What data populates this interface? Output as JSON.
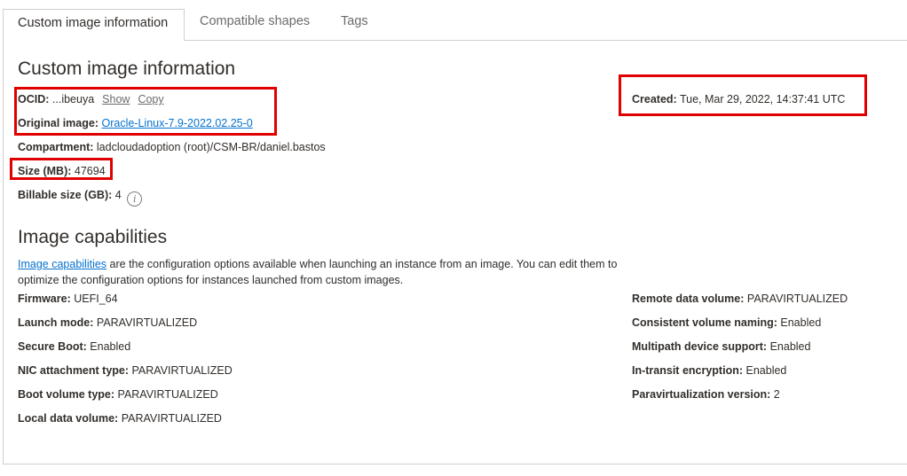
{
  "tabs": [
    {
      "label": "Custom image information",
      "active": true
    },
    {
      "label": "Compatible shapes",
      "active": false
    },
    {
      "label": "Tags",
      "active": false
    }
  ],
  "info": {
    "heading": "Custom image information",
    "ocid_label": "OCID:",
    "ocid_value": "...ibeuya",
    "show_link": "Show",
    "copy_link": "Copy",
    "original_image_label": "Original image:",
    "original_image_value": "Oracle-Linux-7.9-2022.02.25-0",
    "compartment_label": "Compartment:",
    "compartment_value": "ladcloudadoption (root)/CSM-BR/daniel.bastos",
    "size_label": "Size (MB):",
    "size_value": "47694",
    "billable_label": "Billable size (GB):",
    "billable_value": "4",
    "created_label": "Created:",
    "created_value": "Tue, Mar 29, 2022, 14:37:41 UTC"
  },
  "capabilities": {
    "heading": "Image capabilities",
    "desc_link": "Image capabilities",
    "desc_text": " are the configuration options available when launching an instance from an image. You can edit them to optimize the configuration options for instances launched from custom images.",
    "left": [
      {
        "label": "Firmware:",
        "value": "UEFI_64"
      },
      {
        "label": "Launch mode:",
        "value": "PARAVIRTUALIZED"
      },
      {
        "label": "Secure Boot:",
        "value": "Enabled"
      },
      {
        "label": "NIC attachment type:",
        "value": "PARAVIRTUALIZED"
      },
      {
        "label": "Boot volume type:",
        "value": "PARAVIRTUALIZED"
      },
      {
        "label": "Local data volume:",
        "value": "PARAVIRTUALIZED"
      }
    ],
    "right": [
      {
        "label": "Remote data volume:",
        "value": "PARAVIRTUALIZED"
      },
      {
        "label": "Consistent volume naming:",
        "value": "Enabled"
      },
      {
        "label": "Multipath device support:",
        "value": "Enabled"
      },
      {
        "label": "In-transit encryption:",
        "value": "Enabled"
      },
      {
        "label": "Paravirtualization version:",
        "value": "2"
      }
    ]
  },
  "colors": {
    "link": "#0572ce",
    "highlight": "#e00000",
    "border": "#cfcfcf"
  },
  "icons": {
    "billable_info": "info-icon"
  }
}
